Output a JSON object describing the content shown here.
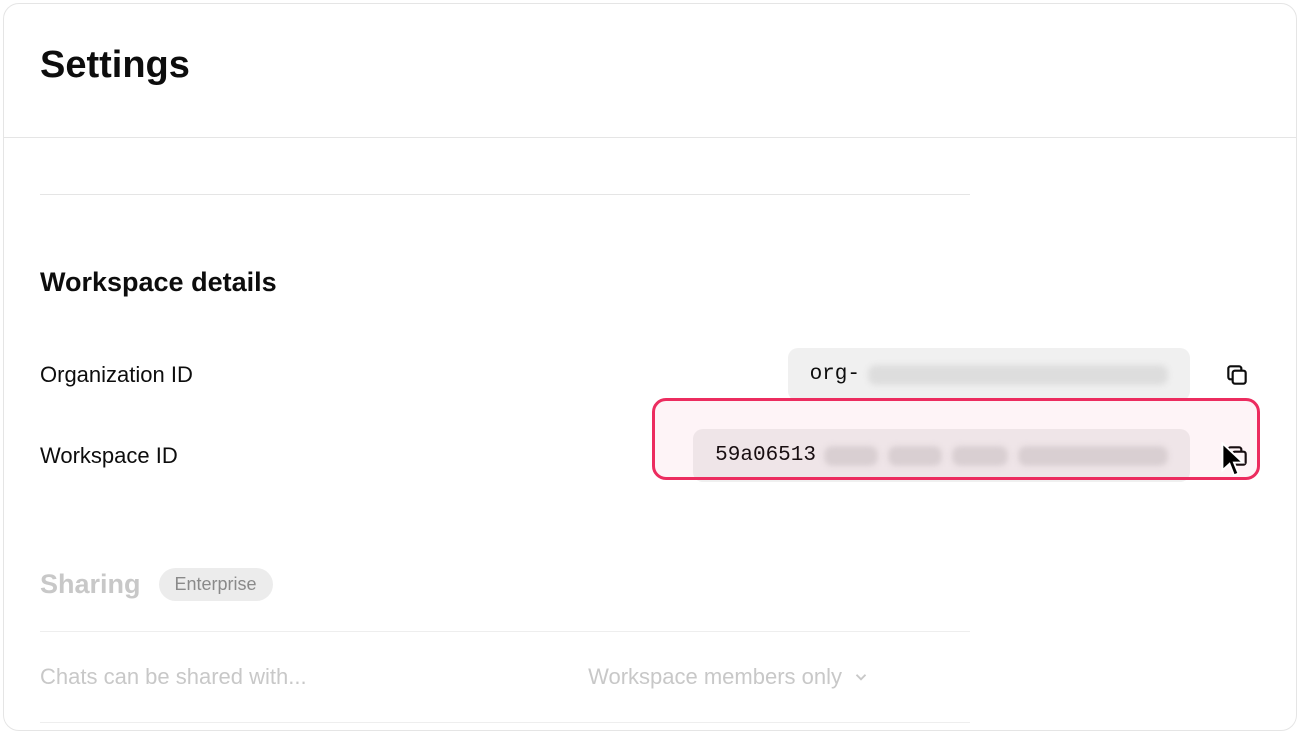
{
  "header": {
    "title": "Settings"
  },
  "workspace_details": {
    "section_title": "Workspace details",
    "org_id": {
      "label": "Organization ID",
      "value_prefix": "org-"
    },
    "workspace_id": {
      "label": "Workspace ID",
      "value_prefix": "59a06513"
    }
  },
  "sharing": {
    "title": "Sharing",
    "badge": "Enterprise",
    "row_label": "Chats can be shared with...",
    "selected_option": "Workspace members only"
  }
}
